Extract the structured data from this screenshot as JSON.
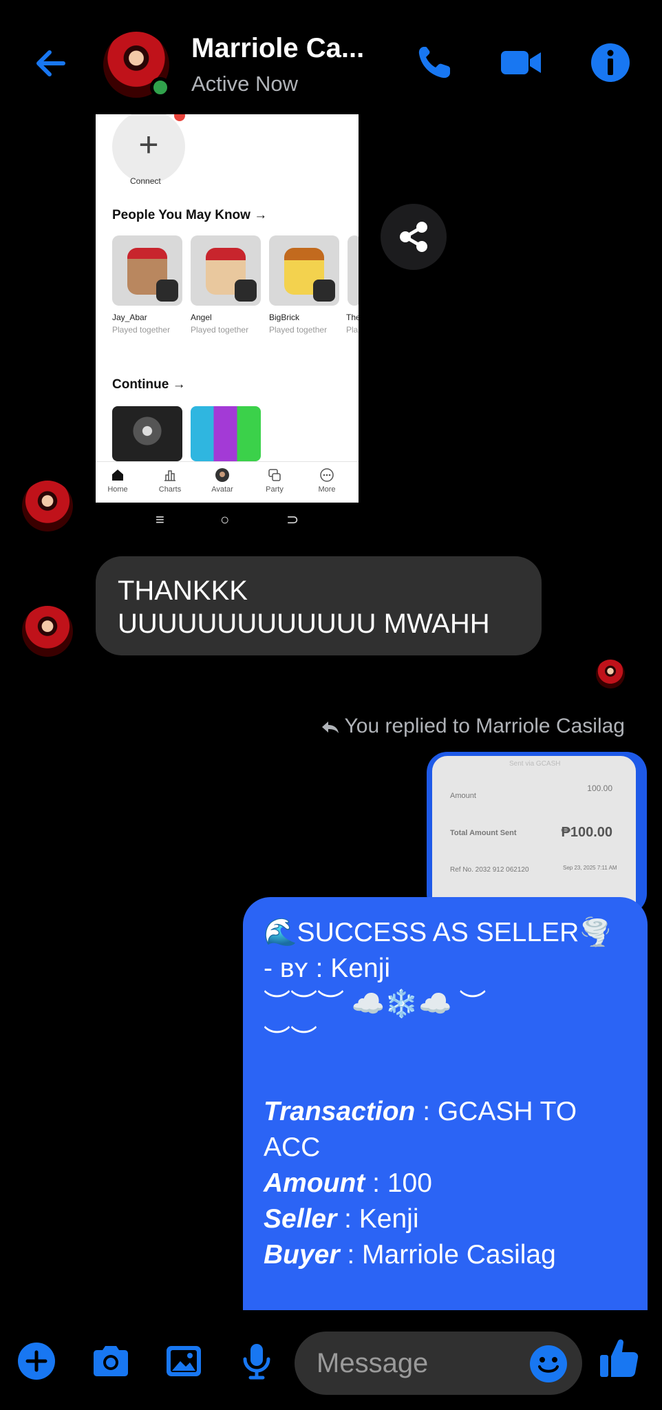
{
  "header": {
    "contact_name": "Marriole Ca...",
    "status": "Active Now"
  },
  "shared_image": {
    "connect_label": "Connect",
    "people_title": "People You May Know →",
    "friends": [
      {
        "name": "Jay_Abar",
        "sub": "Played together"
      },
      {
        "name": "Angel",
        "sub": "Played together"
      },
      {
        "name": "BigBrick",
        "sub": "Played together"
      },
      {
        "name": "The",
        "sub": "Pla"
      }
    ],
    "continue_title": "Continue →",
    "nav": [
      "Home",
      "Charts",
      "Avatar",
      "Party",
      "More"
    ],
    "system_nav": [
      "≡",
      "○",
      "⊃"
    ]
  },
  "messages": {
    "incoming": [
      "THANKKK",
      "UUUUUUUUUUUUU MWAHH"
    ],
    "reply_note": "You replied to Marriole Casilag",
    "receipt": {
      "header_faint": "Sent via GCASH",
      "amount_label": "Amount",
      "amount_value": "100.00",
      "total_label": "Total Amount Sent",
      "total_value": "₱100.00",
      "ref": "Ref No. 2032 912 062120",
      "date": "Sep 23, 2025 7:11 AM"
    },
    "outgoing": {
      "line1": "🌊SUCCESS AS SELLER🌪️",
      "line2": "- ʙʏ : Kenji",
      "line3": "︶︶︶ ☁️❄️☁️ ︶",
      "line4": "︶︶",
      "transaction_label": "Transaction",
      "transaction_value": " : GCASH TO",
      "transaction_value2": "ACC",
      "amount_label": "Amount",
      "amount_value": " : 100",
      "seller_label": "Seller",
      "seller_value": " : Kenji",
      "buyer_label": "Buyer",
      "buyer_value": " : Marriole Casilag"
    }
  },
  "composer": {
    "placeholder": "Message"
  },
  "colors": {
    "accent": "#2b64f5",
    "icon_blue": "#1877f2",
    "incoming_bubble": "#303030",
    "online": "#31a24c"
  }
}
